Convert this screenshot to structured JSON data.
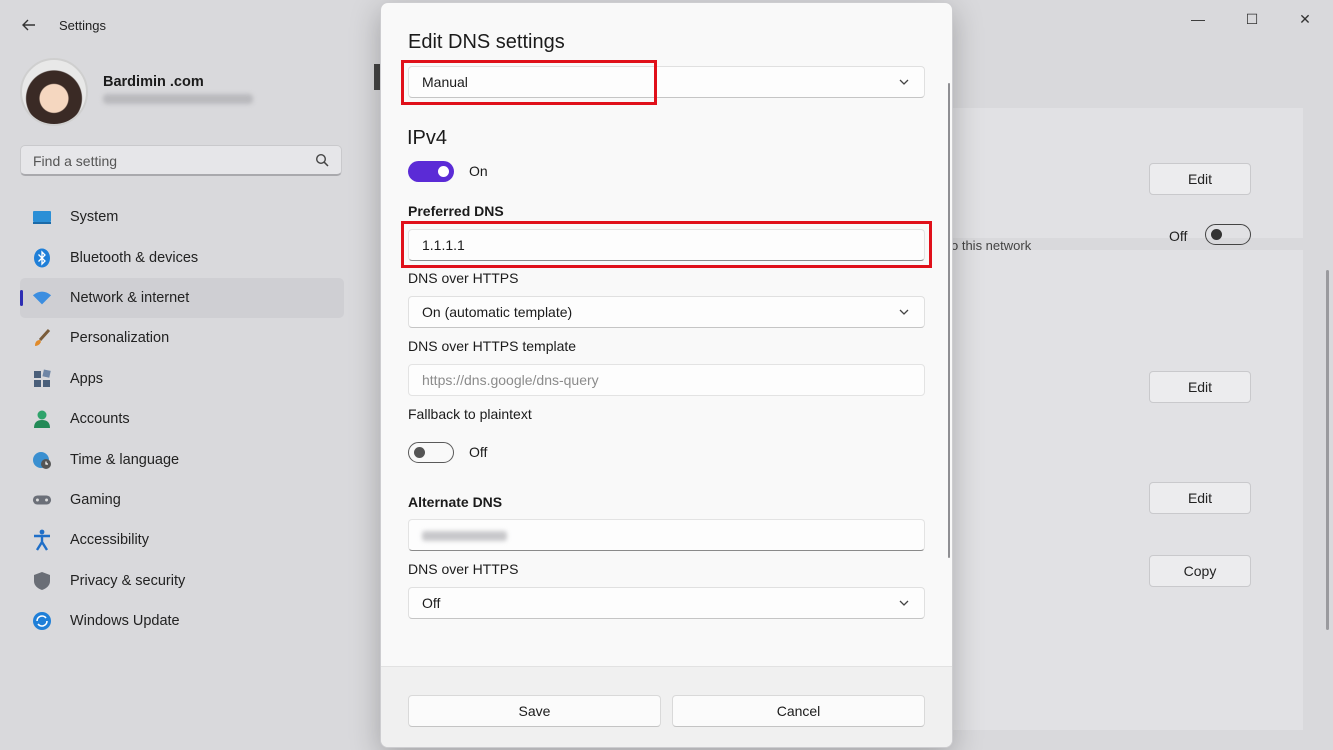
{
  "window": {
    "title": "Settings",
    "controls": [
      "—",
      "☐",
      "✕"
    ]
  },
  "profile": {
    "name": "Bardimin .com"
  },
  "search": {
    "placeholder": "Find a setting"
  },
  "sidebar": {
    "items": [
      {
        "label": "System",
        "icon": "monitor-icon"
      },
      {
        "label": "Bluetooth & devices",
        "icon": "bluetooth-icon"
      },
      {
        "label": "Network & internet",
        "icon": "wifi-icon",
        "active": true
      },
      {
        "label": "Personalization",
        "icon": "brush-icon"
      },
      {
        "label": "Apps",
        "icon": "apps-icon"
      },
      {
        "label": "Accounts",
        "icon": "person-icon"
      },
      {
        "label": "Time & language",
        "icon": "globe-clock-icon"
      },
      {
        "label": "Gaming",
        "icon": "gamepad-icon"
      },
      {
        "label": "Accessibility",
        "icon": "accessibility-icon"
      },
      {
        "label": "Privacy & security",
        "icon": "shield-icon"
      },
      {
        "label": "Windows Update",
        "icon": "update-icon"
      }
    ]
  },
  "background": {
    "edit_label": "Edit",
    "copy_label": "Copy",
    "off_label": "Off",
    "network_text": "o this network"
  },
  "dialog": {
    "title": "Edit DNS settings",
    "mode": "Manual",
    "section": "IPv4",
    "ipv4_toggle": "On",
    "preferred_dns_label": "Preferred DNS",
    "preferred_dns_value": "1.1.1.1",
    "doh_label": "DNS over HTTPS",
    "doh_value": "On (automatic template)",
    "doh_template_label": "DNS over HTTPS template",
    "doh_template_placeholder": "https://dns.google/dns-query",
    "fallback_label": "Fallback to plaintext",
    "fallback_toggle": "Off",
    "alternate_dns_label": "Alternate DNS",
    "alt_doh_label": "DNS over HTTPS",
    "alt_doh_value": "Off",
    "save_label": "Save",
    "cancel_label": "Cancel"
  },
  "colors": {
    "accent": "#5b2bd6",
    "highlight": "#e0101a",
    "nav_indicator": "#2d2db3"
  }
}
